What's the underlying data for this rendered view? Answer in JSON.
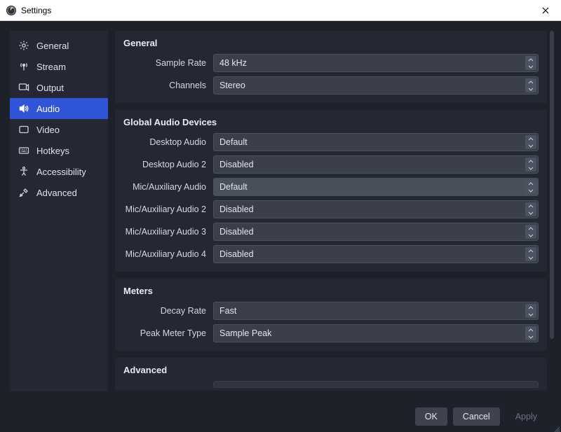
{
  "window": {
    "title": "Settings"
  },
  "sidebar": {
    "items": [
      {
        "label": "General"
      },
      {
        "label": "Stream"
      },
      {
        "label": "Output"
      },
      {
        "label": "Audio"
      },
      {
        "label": "Video"
      },
      {
        "label": "Hotkeys"
      },
      {
        "label": "Accessibility"
      },
      {
        "label": "Advanced"
      }
    ],
    "active_index": 3
  },
  "sections": {
    "general": {
      "title": "General",
      "sample_rate": {
        "label": "Sample Rate",
        "value": "48 kHz"
      },
      "channels": {
        "label": "Channels",
        "value": "Stereo"
      }
    },
    "global_audio_devices": {
      "title": "Global Audio Devices",
      "desktop_audio": {
        "label": "Desktop Audio",
        "value": "Default"
      },
      "desktop_audio_2": {
        "label": "Desktop Audio 2",
        "value": "Disabled"
      },
      "mic_aux": {
        "label": "Mic/Auxiliary Audio",
        "value": "Default"
      },
      "mic_aux_2": {
        "label": "Mic/Auxiliary Audio 2",
        "value": "Disabled"
      },
      "mic_aux_3": {
        "label": "Mic/Auxiliary Audio 3",
        "value": "Disabled"
      },
      "mic_aux_4": {
        "label": "Mic/Auxiliary Audio 4",
        "value": "Disabled"
      }
    },
    "meters": {
      "title": "Meters",
      "decay_rate": {
        "label": "Decay Rate",
        "value": "Fast"
      },
      "peak_meter_type": {
        "label": "Peak Meter Type",
        "value": "Sample Peak"
      }
    },
    "advanced": {
      "title": "Advanced"
    }
  },
  "footer": {
    "ok": "OK",
    "cancel": "Cancel",
    "apply": "Apply"
  }
}
